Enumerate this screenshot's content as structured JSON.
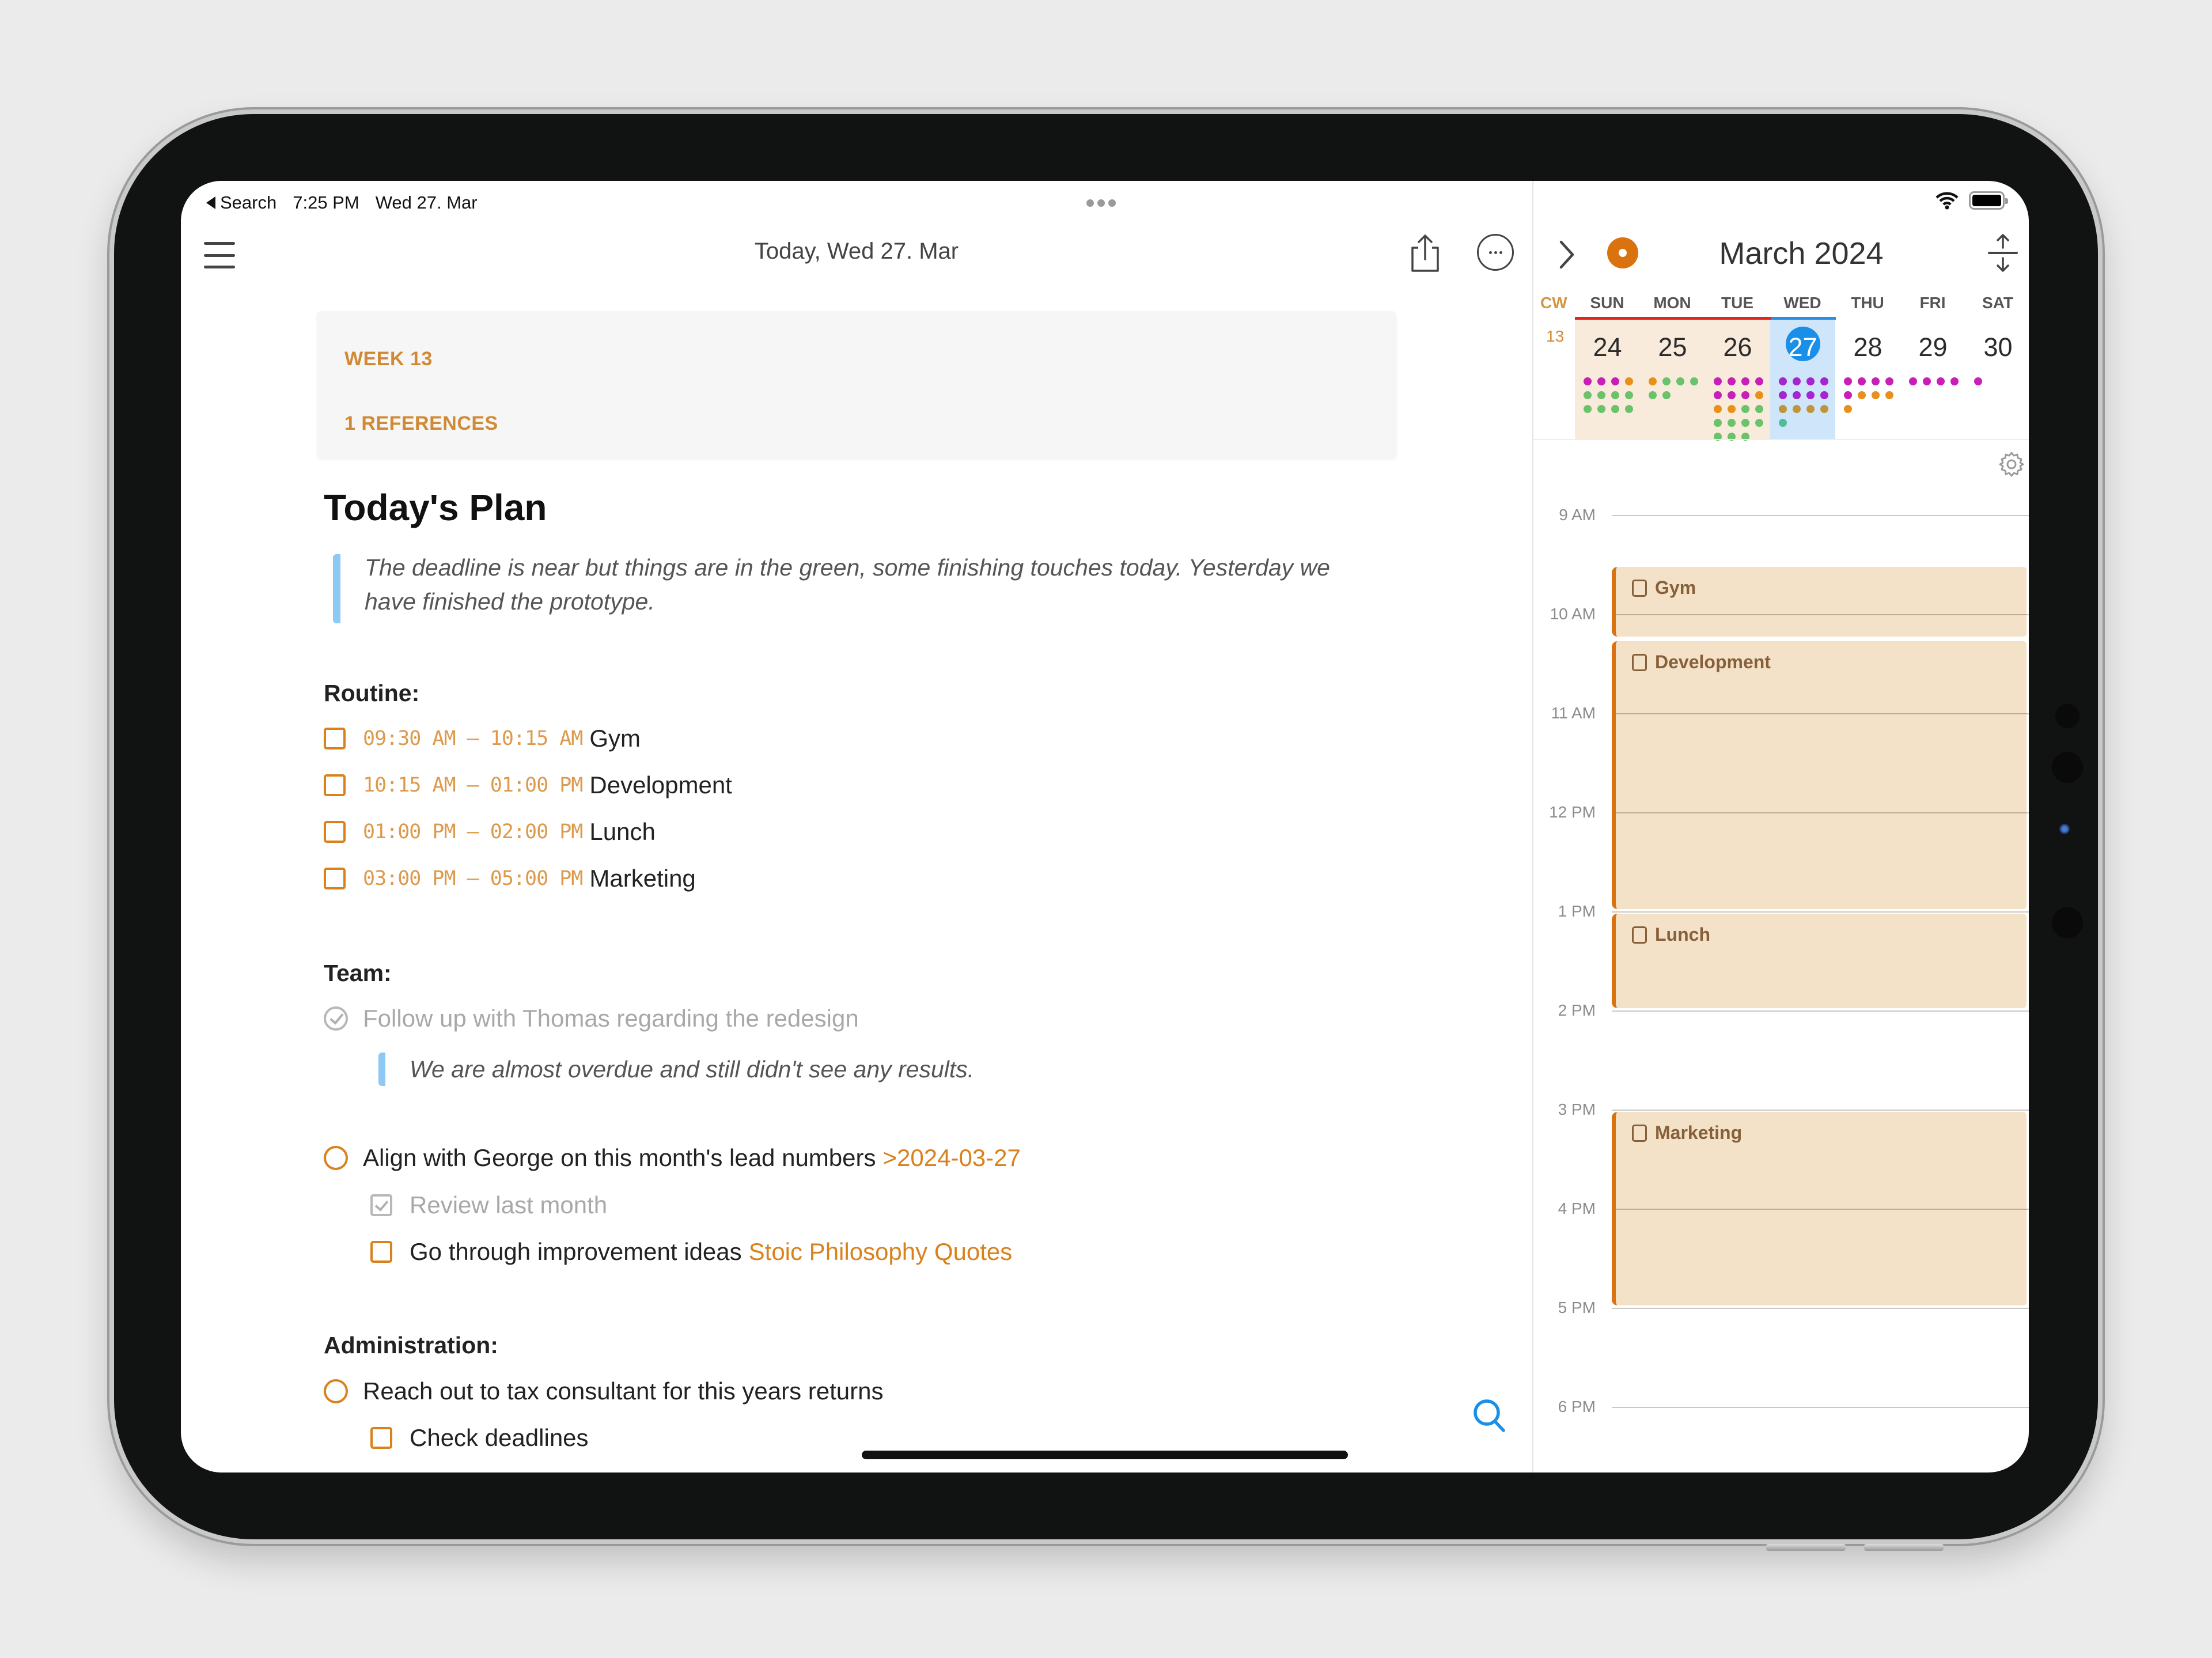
{
  "status_bar": {
    "back_label": "Search",
    "time": "7:25 PM",
    "date": "Wed 27. Mar"
  },
  "toolbar": {
    "title": "Today, Wed 27. Mar",
    "icons": [
      "menu-icon",
      "share-icon",
      "more-icon"
    ]
  },
  "info_card": {
    "week_label": "WEEK 13",
    "references_label": "1 REFERENCES"
  },
  "note": {
    "title": "Today's Plan",
    "intro_quote": "The deadline is near but things are in the green, some finishing touches today. Yesterday we have finished the prototype.",
    "sections": [
      {
        "heading": "Routine:",
        "items": [
          {
            "time": "09:30 AM – 10:15 AM",
            "label": "Gym",
            "type": "checkbox",
            "done": false
          },
          {
            "time": "10:15 AM – 01:00 PM",
            "label": "Development",
            "type": "checkbox",
            "done": false
          },
          {
            "time": "01:00 PM – 02:00 PM",
            "label": "Lunch",
            "type": "checkbox",
            "done": false
          },
          {
            "time": "03:00 PM – 05:00 PM",
            "label": "Marketing",
            "type": "checkbox",
            "done": false
          }
        ]
      },
      {
        "heading": "Team:",
        "items": [
          {
            "label": "Follow up with Thomas regarding the redesign",
            "type": "circle",
            "done": true,
            "quote": "We are almost overdue and still didn't see any results."
          },
          {
            "label": "Align with George on this month's lead numbers",
            "type": "circle",
            "done": false,
            "date_link": ">2024-03-27",
            "subitems": [
              {
                "label": "Review last month",
                "type": "checkbox",
                "done": true
              },
              {
                "label": "Go through improvement ideas",
                "type": "checkbox",
                "done": false,
                "link": "Stoic Philosophy Quotes"
              }
            ]
          }
        ]
      },
      {
        "heading": "Administration:",
        "items": [
          {
            "label": "Reach out to tax consultant for this years returns",
            "type": "circle",
            "done": false,
            "subitems": [
              {
                "label": "Check deadlines",
                "type": "checkbox",
                "done": false
              }
            ]
          }
        ]
      }
    ]
  },
  "calendar": {
    "title": "March 2024",
    "cw_label": "CW",
    "week_number": "13",
    "weekday_labels": [
      "SUN",
      "MON",
      "TUE",
      "WED",
      "THU",
      "FRI",
      "SAT"
    ],
    "days": [
      {
        "num": "24",
        "state": "past",
        "dots": [
          "magenta",
          "magenta",
          "magenta",
          "orange",
          "green",
          "green",
          "green",
          "green",
          "green",
          "green",
          "green",
          "green"
        ]
      },
      {
        "num": "25",
        "state": "past",
        "dots": [
          "orange",
          "green",
          "green",
          "green",
          "green",
          "green"
        ]
      },
      {
        "num": "26",
        "state": "past",
        "dots": [
          "magenta",
          "magenta",
          "magenta",
          "magenta",
          "magenta",
          "magenta",
          "magenta",
          "orange",
          "orange",
          "orange",
          "green",
          "green",
          "green",
          "green",
          "green",
          "green",
          "green",
          "green",
          "green"
        ]
      },
      {
        "num": "27",
        "state": "today",
        "dots": [
          "purple",
          "purple",
          "purple",
          "purple",
          "purple",
          "purple",
          "purple",
          "purple",
          "olive",
          "olive",
          "olive",
          "olive",
          "teal"
        ]
      },
      {
        "num": "28",
        "state": "future",
        "dots": [
          "magenta",
          "magenta",
          "magenta",
          "magenta",
          "magenta",
          "orange",
          "orange",
          "orange",
          "orange"
        ]
      },
      {
        "num": "29",
        "state": "future",
        "dots": [
          "magenta",
          "magenta",
          "magenta",
          "magenta"
        ]
      },
      {
        "num": "30",
        "state": "future",
        "dots": [
          "magenta"
        ]
      }
    ],
    "dot_colors": {
      "magenta": "#c81fb8",
      "orange": "#e8901a",
      "green": "#6cc16b",
      "purple": "#a326d0",
      "olive": "#c0943a",
      "teal": "#4cbf9a"
    },
    "hours": [
      "9 AM",
      "10 AM",
      "11 AM",
      "12 PM",
      "1 PM",
      "2 PM",
      "3 PM",
      "4 PM",
      "5 PM",
      "6 PM"
    ],
    "first_hour": 9,
    "events": [
      {
        "label": "Gym",
        "start": 9.5,
        "end": 10.25
      },
      {
        "label": "Development",
        "start": 10.25,
        "end": 13.0
      },
      {
        "label": "Lunch",
        "start": 13.0,
        "end": 14.0
      },
      {
        "label": "Marketing",
        "start": 15.0,
        "end": 17.0
      }
    ]
  },
  "colors": {
    "accent": "#d9821d",
    "event_bg": "#f4e2c8",
    "event_bar": "#d9720f",
    "today_blue": "#1a8fe8",
    "quote_bar": "#8ec9f5"
  }
}
